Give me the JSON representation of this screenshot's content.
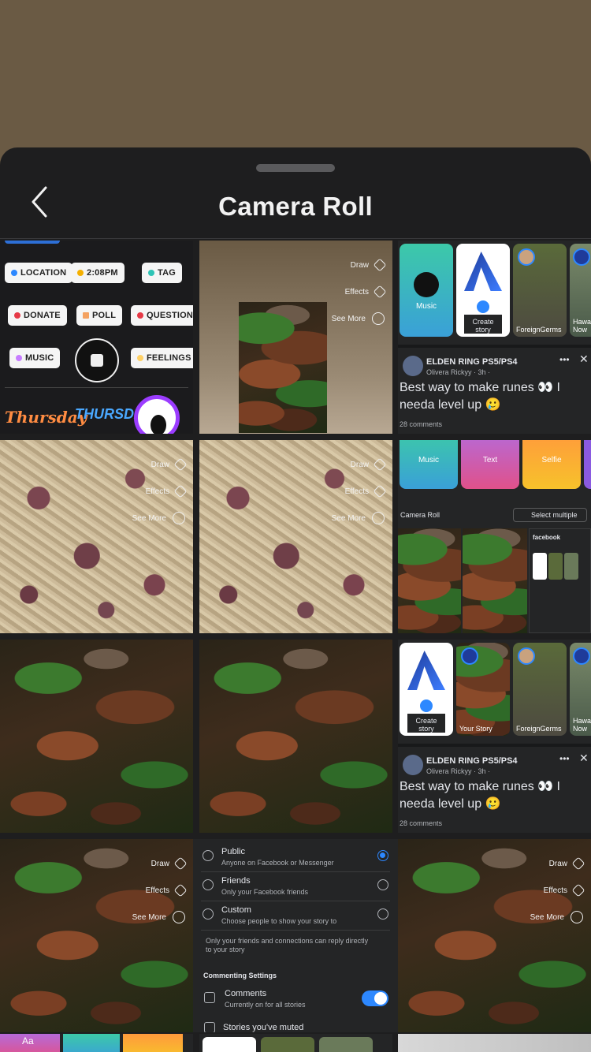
{
  "sheet": {
    "title": "Camera Roll"
  },
  "stickers": {
    "location": "LOCATION",
    "time": "2:08PM",
    "tag": "TAG",
    "donate": "DONATE",
    "poll": "POLL",
    "question": "QUESTION",
    "music": "MUSIC",
    "feelings": "FEELINGS",
    "thursday1": "Thursday",
    "thursday2": "THURSDAY"
  },
  "edit_tools": {
    "draw": "Draw",
    "effects": "Effects",
    "see_more": "See More"
  },
  "story_tray": {
    "music": "Music",
    "create_story": "Create story",
    "foreign_germs": "ForeignGerms",
    "hawaii_now": "Hawa Now",
    "your_story": "Your Story",
    "text": "Text",
    "selfie": "Selfie"
  },
  "post": {
    "group": "ELDEN RING PS5/PS4",
    "author": "Olivera Rickyy · 3h ·",
    "text": "Best way to make runes 👀 I needa level up 🥲",
    "comments": "28 comments"
  },
  "camera_roll_mini": {
    "label": "Camera Roll",
    "select_multiple": "Select multiple",
    "facebook": "facebook"
  },
  "privacy": {
    "public_label": "Public",
    "public_desc": "Anyone on Facebook or Messenger",
    "friends_label": "Friends",
    "friends_desc": "Only your Facebook friends",
    "custom_label": "Custom",
    "custom_desc": "Choose people to show your story to",
    "note": "Only your friends and connections can reply directly to your story",
    "commenting_heading": "Commenting Settings",
    "comments_label": "Comments",
    "comments_desc": "Currently on for all stories",
    "muted_label": "Stories you've muted"
  },
  "partial_strip": {
    "aa": "Aa"
  },
  "colors": {
    "sheet_bg": "#1e1e1f",
    "accent_blue": "#2d88ff",
    "backdrop": "#6a5a44"
  }
}
